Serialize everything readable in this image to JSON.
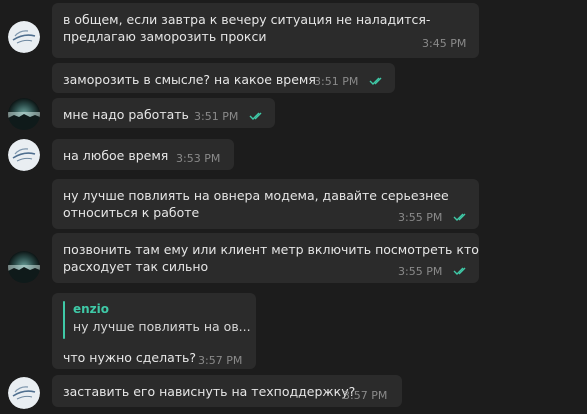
{
  "colors": {
    "background": "#1c1c1c",
    "bubble": "#2b2b2b",
    "text": "#e6e6e6",
    "meta": "#8a8a8a",
    "check": "#3fc9a7",
    "reply_name": "#3fc9a7"
  },
  "messages": [
    {
      "id": "m1",
      "lines": [
        "в общем, если завтра к вечеру ситуация не наладится-",
        "предлагаю заморозить прокси"
      ],
      "time": "3:45 PM",
      "read_icon": "",
      "avatar": "ship-logo-avatar"
    },
    {
      "id": "m2",
      "lines": [
        "заморозить в смысле? на какое время"
      ],
      "time": "3:51 PM",
      "read_icon": "double-check-icon",
      "avatar": ""
    },
    {
      "id": "m3",
      "lines": [
        "мне надо работать"
      ],
      "time": "3:51 PM",
      "read_icon": "double-check-icon",
      "avatar": "dark-landscape-avatar"
    },
    {
      "id": "m4",
      "lines": [
        "на любое время"
      ],
      "time": "3:53 PM",
      "read_icon": "",
      "avatar": "ship-logo-avatar"
    },
    {
      "id": "m5",
      "lines": [
        "ну лучше повлиять на овнера модема, давайте серьезнее",
        "относиться к работе"
      ],
      "time": "3:55 PM",
      "read_icon": "double-check-icon",
      "avatar": ""
    },
    {
      "id": "m6",
      "lines": [
        "позвонить там ему или клиент метр включить посмотреть кто",
        "расходует так сильно"
      ],
      "time": "3:55 PM",
      "read_icon": "double-check-icon",
      "avatar": "dark-landscape-avatar"
    },
    {
      "id": "m7",
      "reply": {
        "name": "enzio",
        "text": "ну лучше повлиять на ов..."
      },
      "lines": [
        "что нужно сделать?"
      ],
      "time": "3:57 PM",
      "read_icon": "",
      "avatar": ""
    },
    {
      "id": "m8",
      "lines": [
        "заставить его нависнуть на техподдержку?"
      ],
      "time": "3:57 PM",
      "read_icon": "",
      "avatar": "ship-logo-avatar"
    }
  ]
}
